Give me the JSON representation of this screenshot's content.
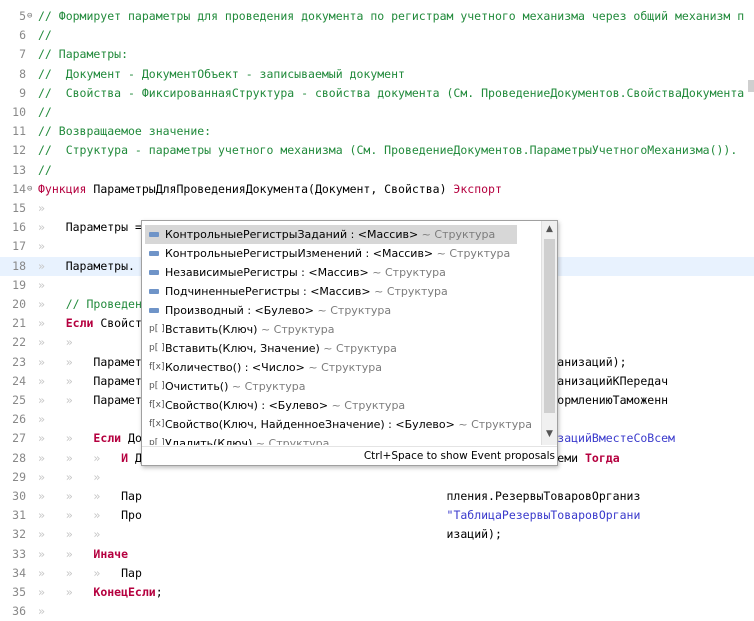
{
  "editor": {
    "lines": [
      {
        "n": "5",
        "f": "⊖",
        "segs": [
          {
            "c": "cm",
            "t": "// Формирует параметры для проведения документа по регистрам учетного механизма через общий механизм п"
          }
        ]
      },
      {
        "n": "6",
        "segs": [
          {
            "c": "cm",
            "t": "//"
          }
        ]
      },
      {
        "n": "7",
        "segs": [
          {
            "c": "cm",
            "t": "// Параметры:"
          }
        ]
      },
      {
        "n": "8",
        "segs": [
          {
            "c": "cm",
            "t": "//  Документ - ДокументОбъект - записываемый документ"
          }
        ]
      },
      {
        "n": "9",
        "segs": [
          {
            "c": "cm",
            "t": "//  Свойства - ФиксированнаяСтруктура - свойства документа (См. ПроведениеДокументов.СвойстваДокумента"
          }
        ]
      },
      {
        "n": "10",
        "segs": [
          {
            "c": "cm",
            "t": "//"
          }
        ]
      },
      {
        "n": "11",
        "segs": [
          {
            "c": "cm",
            "t": "// Возвращаемое значение:"
          }
        ]
      },
      {
        "n": "12",
        "segs": [
          {
            "c": "cm",
            "t": "//  Структура - параметры учетного механизма (См. ПроведениеДокументов.ПараметрыУчетногоМеханизма())."
          }
        ]
      },
      {
        "n": "13",
        "segs": [
          {
            "c": "cm",
            "t": "//"
          }
        ]
      },
      {
        "n": "14",
        "f": "⊖",
        "segs": [
          {
            "c": "kw",
            "t": "Функция "
          },
          {
            "c": "",
            "t": "ПараметрыДляПроведенияДокумента(Документ, Свойства) "
          },
          {
            "c": "kw",
            "t": "Экспорт"
          }
        ]
      },
      {
        "n": "15",
        "segs": [
          {
            "c": "ws",
            "t": "»"
          }
        ]
      },
      {
        "n": "16",
        "segs": [
          {
            "c": "ws",
            "t": "»   "
          },
          {
            "c": "",
            "t": "Параметры = ПроведениеДокументов.ПараметрыУчетногоМеханизма();"
          }
        ]
      },
      {
        "n": "17",
        "segs": [
          {
            "c": "ws",
            "t": "»"
          }
        ]
      },
      {
        "n": "18",
        "cur": true,
        "segs": [
          {
            "c": "ws",
            "t": "»   "
          },
          {
            "c": "",
            "t": "Параметры."
          }
        ]
      },
      {
        "n": "19",
        "segs": [
          {
            "c": "ws",
            "t": "»"
          }
        ]
      },
      {
        "n": "20",
        "segs": [
          {
            "c": "ws",
            "t": "»   "
          },
          {
            "c": "cm",
            "t": "// Проведен"
          }
        ]
      },
      {
        "n": "21",
        "segs": [
          {
            "c": "ws",
            "t": "»   "
          },
          {
            "c": "kwb",
            "t": "Если "
          },
          {
            "c": "",
            "t": "Свойст"
          }
        ]
      },
      {
        "n": "22",
        "segs": [
          {
            "c": "ws",
            "t": "»   »"
          }
        ]
      },
      {
        "n": "23",
        "segs": [
          {
            "c": "ws",
            "t": "»   »   "
          },
          {
            "c": "",
            "t": "Парамет                                                ия.ТоварыОрганизаций);"
          }
        ]
      },
      {
        "n": "24",
        "segs": [
          {
            "c": "ws",
            "t": "»   »   "
          },
          {
            "c": "",
            "t": "Парамет                                                ия.ТоварыОрганизацийКПередач"
          }
        ]
      },
      {
        "n": "25",
        "segs": [
          {
            "c": "ws",
            "t": "»   »   "
          },
          {
            "c": "",
            "t": "Парамет                                                ия.ТоварыКОформлениюТаможенн"
          }
        ]
      },
      {
        "n": "26",
        "segs": [
          {
            "c": "ws",
            "t": "»"
          }
        ]
      },
      {
        "n": "27",
        "segs": [
          {
            "c": "ws",
            "t": "»   »   "
          },
          {
            "c": "kwb",
            "t": "Если "
          },
          {
            "c": "",
            "t": "До                                                 "
          },
          {
            "c": "str",
            "t": "вароВОрганизацийВместеСоВсем"
          }
        ]
      },
      {
        "n": "28",
        "segs": [
          {
            "c": "ws",
            "t": "»   »   »   "
          },
          {
            "c": "kwb",
            "t": "И "
          },
          {
            "c": "",
            "t": "Д                                           низацийВместеСоВсеми "
          },
          {
            "c": "kwb",
            "t": "Тогда"
          }
        ]
      },
      {
        "n": "29",
        "segs": [
          {
            "c": "ws",
            "t": "»   »   »"
          }
        ]
      },
      {
        "n": "30",
        "segs": [
          {
            "c": "ws",
            "t": "»   »   »   "
          },
          {
            "c": "",
            "t": "Пар                                            пления.РезервыТоваровОрганиз"
          }
        ]
      },
      {
        "n": "31",
        "segs": [
          {
            "c": "ws",
            "t": "»   »   »   "
          },
          {
            "c": "",
            "t": "Про                                            "
          },
          {
            "c": "str",
            "t": "\"ТаблицаРезервыТоваровОргани"
          }
        ]
      },
      {
        "n": "32",
        "segs": [
          {
            "c": "ws",
            "t": "»   »   »   "
          },
          {
            "c": "",
            "t": "                                               изаций);"
          }
        ]
      },
      {
        "n": "33",
        "segs": [
          {
            "c": "ws",
            "t": "»   »   "
          },
          {
            "c": "kwb",
            "t": "Иначе"
          }
        ]
      },
      {
        "n": "34",
        "segs": [
          {
            "c": "ws",
            "t": "»   »   »   "
          },
          {
            "c": "",
            "t": "Пар"
          }
        ]
      },
      {
        "n": "35",
        "segs": [
          {
            "c": "ws",
            "t": "»   »   "
          },
          {
            "c": "kwb",
            "t": "КонецЕсли"
          },
          {
            "c": "",
            "t": ";"
          }
        ]
      },
      {
        "n": "36",
        "segs": [
          {
            "c": "ws",
            "t": "»"
          }
        ]
      }
    ]
  },
  "popup": {
    "items": [
      {
        "icon": "property-icon",
        "name": "КонтрольныеРегистрыЗаданий : <Массив>",
        "type": " ~ Структура",
        "selected": true
      },
      {
        "icon": "property-icon",
        "name": "КонтрольныеРегистрыИзменений : <Массив>",
        "type": " ~ Структура"
      },
      {
        "icon": "property-icon",
        "name": "НезависимыеРегистры : <Массив>",
        "type": " ~ Структура"
      },
      {
        "icon": "property-icon",
        "name": "ПодчиненныеРегистры : <Массив>",
        "type": " ~ Структура"
      },
      {
        "icon": "property-icon",
        "name": "Производный : <Булево>",
        "type": " ~ Структура"
      },
      {
        "icon": "procedure-icon",
        "glyph": "p[ ]",
        "name": "Вставить(Ключ)",
        "type": " ~ Структура"
      },
      {
        "icon": "procedure-icon",
        "glyph": "p[ ]",
        "name": "Вставить(Ключ, Значение)",
        "type": " ~ Структура"
      },
      {
        "icon": "function-icon",
        "glyph": "f[x]",
        "name": "Количество() : <Число>",
        "type": " ~ Структура"
      },
      {
        "icon": "procedure-icon",
        "glyph": "p[ ]",
        "name": "Очистить()",
        "type": " ~ Структура"
      },
      {
        "icon": "function-icon",
        "glyph": "f[x]",
        "name": "Свойство(Ключ) : <Булево>",
        "type": " ~ Структура"
      },
      {
        "icon": "function-icon",
        "glyph": "f[x]",
        "name": "Свойство(Ключ, НайденноеЗначение) : <Булево>",
        "type": " ~ Структура"
      },
      {
        "icon": "procedure-icon",
        "glyph": "p[ ]",
        "name": "Удалить(Ключ)",
        "type": " ~ Структура"
      }
    ],
    "footer": "Ctrl+Space to show Event proposals",
    "scroll_up": "▲",
    "scroll_down": "▼"
  }
}
